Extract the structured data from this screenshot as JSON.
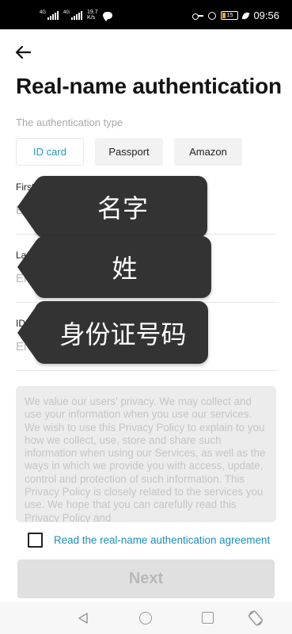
{
  "status_bar": {
    "network_1": "4G",
    "network_2": "4G",
    "speed_value": "19.7",
    "speed_unit": "K/s",
    "battery": "15",
    "time": "09:56"
  },
  "header": {
    "title": "Real-name authentication",
    "type_label": "The authentication type"
  },
  "auth_types": [
    {
      "label": "ID card",
      "selected": true
    },
    {
      "label": "Passport",
      "selected": false
    },
    {
      "label": "Amazon",
      "selected": false
    }
  ],
  "form": {
    "first_name": {
      "label": "First Name",
      "placeholder": "Enter first name",
      "value": ""
    },
    "last_name": {
      "label": "Last Name",
      "placeholder": "Enter last name",
      "value": ""
    },
    "id_card": {
      "label": "ID card",
      "placeholder": "Enter ID number",
      "value": ""
    }
  },
  "annotations": {
    "first_name": "名字",
    "last_name": "姓",
    "id_card": "身份证号码"
  },
  "privacy_text": "We value our users' privacy. We may collect and use your information when you use our services. We wish to use this Privacy Policy to explain to you how we collect, use, store and share such information when using our Services, as well as the ways in which we provide you with access, update, control and protection of such information. This Privacy Policy is closely related to the services you use. We hope that you can carefully read this Privacy Policy and",
  "agreement": {
    "checked": false,
    "label": "Read the real-name authentication agreement"
  },
  "next_label": "Next",
  "colors": {
    "accent": "#2794b8",
    "link": "#1e8db5",
    "disabled_button": "#e0e0e0",
    "tooltip_bg": "#333333"
  },
  "icons": {
    "back": "arrow-left-icon",
    "nav_back": "triangle-back-icon",
    "nav_home": "circle-home-icon",
    "nav_recent": "square-recent-icon",
    "rotate": "rotate-screen-icon"
  }
}
